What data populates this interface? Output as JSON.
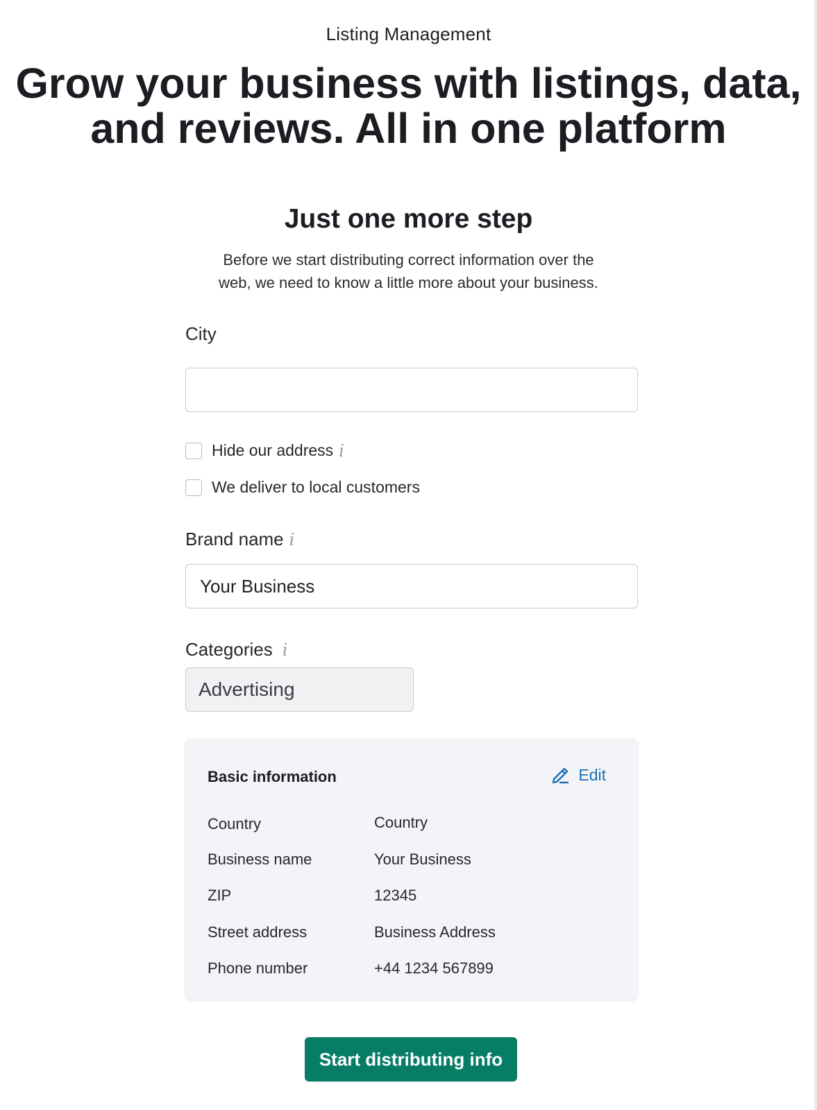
{
  "header": {
    "eyebrow": "Listing Management",
    "headline_line1": "Grow your business with listings, data,",
    "headline_line2": "and reviews. All in one platform"
  },
  "step": {
    "title": "Just one more step",
    "description_line1": "Before we start distributing correct information over the",
    "description_line2": "web, we need to know a little more about your business."
  },
  "form": {
    "city": {
      "label": "City",
      "value": ""
    },
    "checkboxes": [
      {
        "label": "Hide our address",
        "checked": false,
        "has_info": true
      },
      {
        "label": "We deliver to local customers",
        "checked": false,
        "has_info": false
      }
    ],
    "brand_name": {
      "label": "Brand name",
      "value": "Your Business"
    },
    "categories": {
      "label": "Categories",
      "selected": "Advertising"
    }
  },
  "basic_info": {
    "title": "Basic information",
    "edit_label": "Edit",
    "rows": [
      {
        "label": "Country",
        "value": "Country"
      },
      {
        "label": "Business name",
        "value": "Your Business"
      },
      {
        "label": "ZIP",
        "value": "12345"
      },
      {
        "label": "Street address",
        "value": "Business Address"
      },
      {
        "label": "Phone number",
        "value": "+44 1234 567899"
      }
    ]
  },
  "cta": {
    "label": "Start distributing info"
  },
  "icons": {
    "info": "info-icon",
    "edit": "pencil-icon"
  },
  "colors": {
    "primary_button": "#077d66",
    "link": "#1f6fb8",
    "card_background": "#f3f4f7",
    "info_icon": "#9a9ba3"
  }
}
